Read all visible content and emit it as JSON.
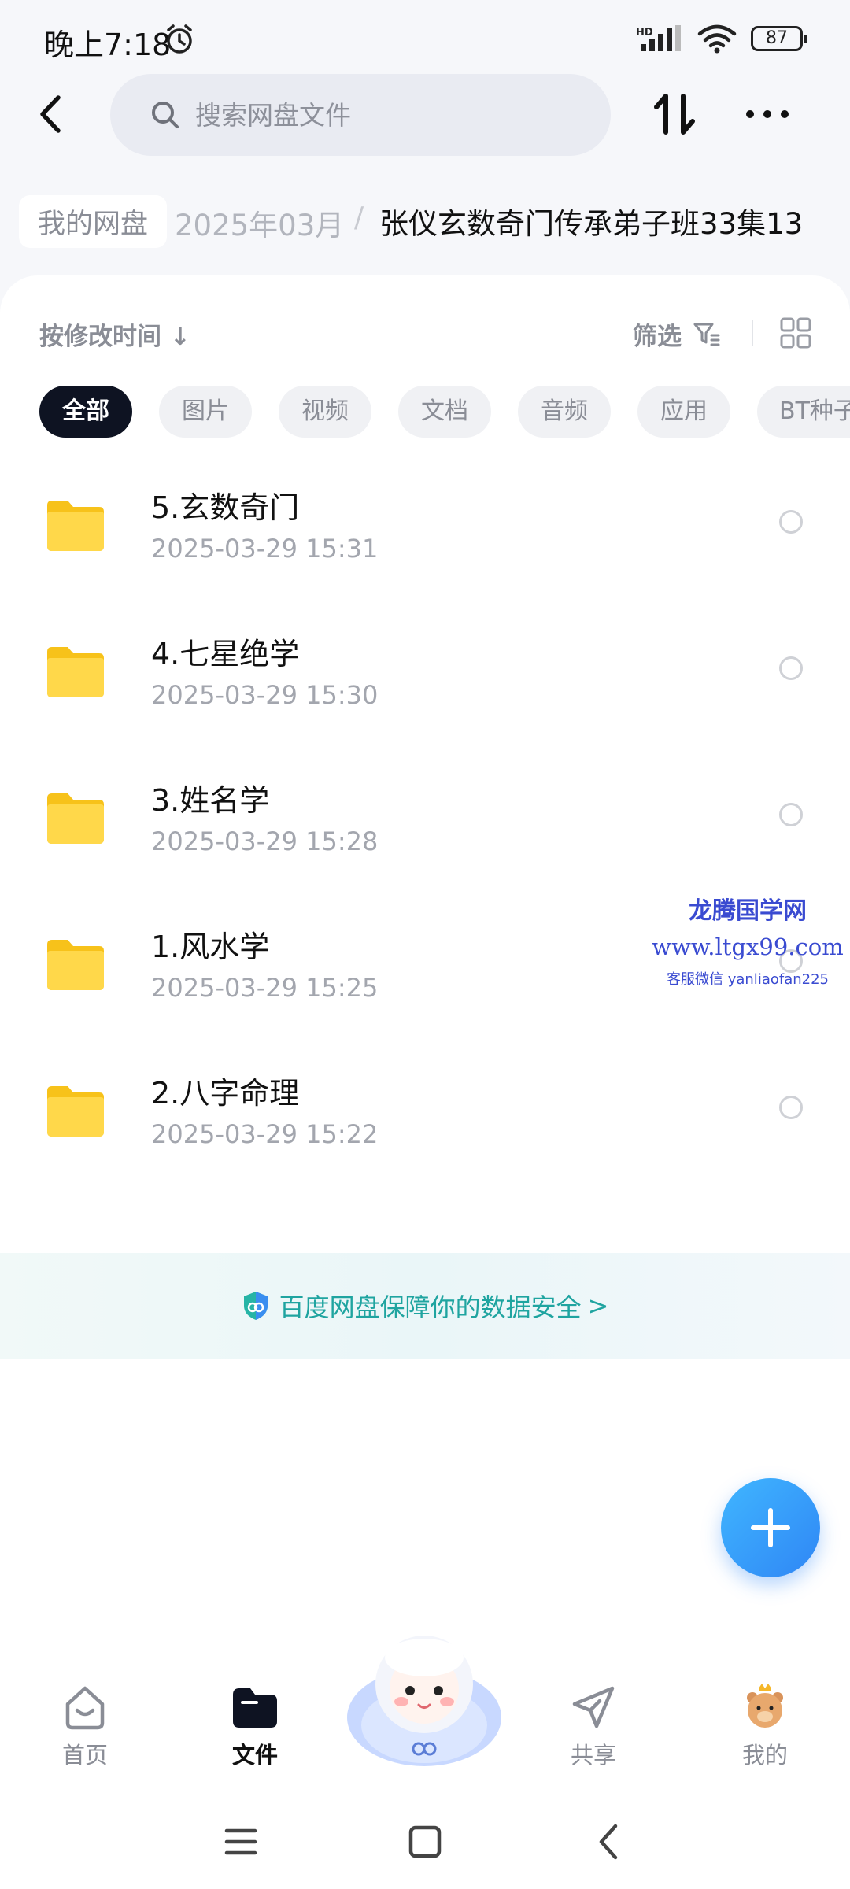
{
  "status_bar": {
    "time": "晚上7:18",
    "network": "HD",
    "battery": "87"
  },
  "search": {
    "placeholder": "搜索网盘文件"
  },
  "breadcrumb": {
    "root": "我的网盘",
    "middle": "2025年03月",
    "separator": "/",
    "current": "张仪玄数奇门传承弟子班33集13"
  },
  "toolbar": {
    "sort_label": "按修改时间 ↓",
    "filter_label": "筛选"
  },
  "chips": [
    {
      "label": "全部",
      "active": true
    },
    {
      "label": "图片"
    },
    {
      "label": "视频"
    },
    {
      "label": "文档"
    },
    {
      "label": "音频"
    },
    {
      "label": "应用"
    },
    {
      "label": "BT种子"
    }
  ],
  "files": [
    {
      "name": "5.玄数奇门",
      "date": "2025-03-29  15:31"
    },
    {
      "name": "4.七星绝学",
      "date": "2025-03-29  15:30"
    },
    {
      "name": "3.姓名学",
      "date": "2025-03-29  15:28"
    },
    {
      "name": "1.风水学",
      "date": "2025-03-29  15:25"
    },
    {
      "name": "2.八字命理",
      "date": "2025-03-29  15:22"
    }
  ],
  "watermark": {
    "title": "龙腾国学网",
    "url": "www.ltgx99.com",
    "contact": "客服微信 yanliaofan225"
  },
  "security_banner": {
    "text": "百度网盘保障你的数据安全",
    "arrow": ">"
  },
  "tabs": [
    {
      "label": "首页",
      "icon": "home-icon"
    },
    {
      "label": "文件",
      "icon": "folder-icon",
      "active": true
    },
    {
      "label": "共享",
      "icon": "share-icon"
    },
    {
      "label": "我的",
      "icon": "profile-icon"
    }
  ],
  "colors": {
    "accent": "#2f86f5",
    "active_chip": "#0e1322",
    "security": "#1fa4a0",
    "folder": "#ffd23f"
  }
}
